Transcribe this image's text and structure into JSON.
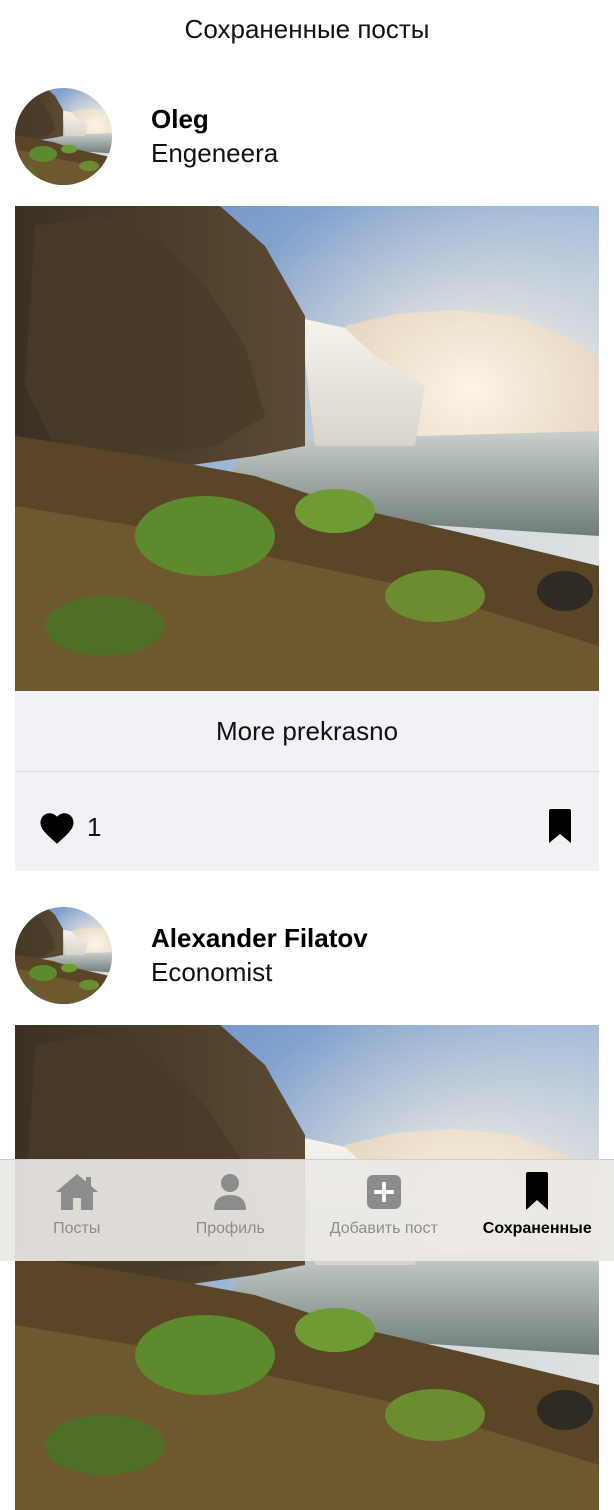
{
  "screen": {
    "title": "Сохраненные посты"
  },
  "posts": [
    {
      "author": "Oleg",
      "role": "Engeneera",
      "text": "More prekrasno",
      "likes": "1",
      "image": "waterfall-photo",
      "saved": true
    },
    {
      "author": "Alexander Filatov",
      "role": "Economist",
      "image": "waterfall-photo"
    }
  ],
  "tabbar": {
    "items": [
      {
        "label": "Посты",
        "icon": "house-icon"
      },
      {
        "label": "Профиль",
        "icon": "person-icon"
      },
      {
        "label": "Добавить пост",
        "icon": "plus-square-icon"
      },
      {
        "label": "Сохраненные",
        "icon": "bookmark-icon",
        "active": true
      }
    ]
  },
  "colors": {
    "footer_bg": "#f1f1f6",
    "tab_active": "#000000",
    "tab_inactive": "#8c8c8c"
  }
}
